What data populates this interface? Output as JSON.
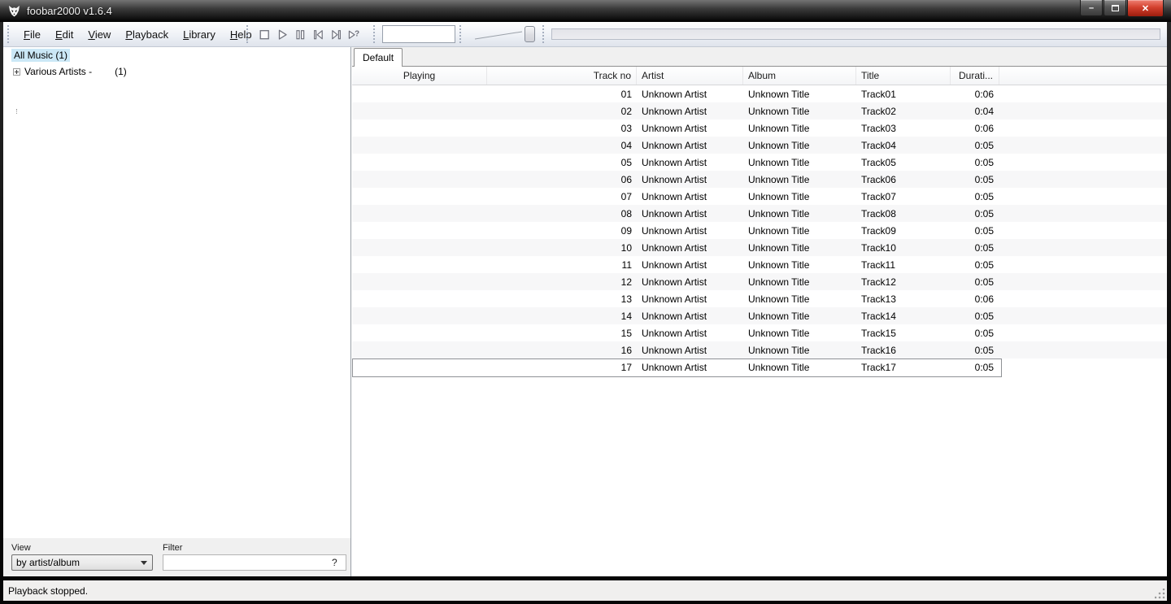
{
  "window": {
    "title": "foobar2000 v1.6.4",
    "controls": {
      "minimize": "–",
      "maximize": "",
      "close": "✕"
    }
  },
  "menu": {
    "items": [
      {
        "label": "File"
      },
      {
        "label": "Edit"
      },
      {
        "label": "View"
      },
      {
        "label": "Playback"
      },
      {
        "label": "Library"
      },
      {
        "label": "Help"
      }
    ]
  },
  "toolbar": {
    "transport_icons": [
      "stop-icon",
      "play-icon",
      "pause-icon",
      "previous-icon",
      "next-icon",
      "random-icon"
    ],
    "search_value": "",
    "volume_icon": "volume-slider",
    "seekbar_icon": "seekbar"
  },
  "library_panel": {
    "selected_node": "All Music (1)",
    "tree": [
      {
        "label": "Various Artists -",
        "count": "(1)"
      }
    ],
    "view_label": "View",
    "view_value": "by artist/album",
    "filter_label": "Filter",
    "filter_value": "",
    "filter_help": "?"
  },
  "playlist": {
    "tab_label": "Default",
    "columns": [
      {
        "key": "playing",
        "label": "Playing"
      },
      {
        "key": "track_no",
        "label": "Track no"
      },
      {
        "key": "artist",
        "label": "Artist"
      },
      {
        "key": "album",
        "label": "Album"
      },
      {
        "key": "title",
        "label": "Title"
      },
      {
        "key": "duration",
        "label": "Durati..."
      }
    ],
    "focused_row_index": 16,
    "rows": [
      {
        "playing": "",
        "track_no": "01",
        "artist": "Unknown Artist",
        "album": "Unknown Title",
        "title": "Track01",
        "duration": "0:06"
      },
      {
        "playing": "",
        "track_no": "02",
        "artist": "Unknown Artist",
        "album": "Unknown Title",
        "title": "Track02",
        "duration": "0:04"
      },
      {
        "playing": "",
        "track_no": "03",
        "artist": "Unknown Artist",
        "album": "Unknown Title",
        "title": "Track03",
        "duration": "0:06"
      },
      {
        "playing": "",
        "track_no": "04",
        "artist": "Unknown Artist",
        "album": "Unknown Title",
        "title": "Track04",
        "duration": "0:05"
      },
      {
        "playing": "",
        "track_no": "05",
        "artist": "Unknown Artist",
        "album": "Unknown Title",
        "title": "Track05",
        "duration": "0:05"
      },
      {
        "playing": "",
        "track_no": "06",
        "artist": "Unknown Artist",
        "album": "Unknown Title",
        "title": "Track06",
        "duration": "0:05"
      },
      {
        "playing": "",
        "track_no": "07",
        "artist": "Unknown Artist",
        "album": "Unknown Title",
        "title": "Track07",
        "duration": "0:05"
      },
      {
        "playing": "",
        "track_no": "08",
        "artist": "Unknown Artist",
        "album": "Unknown Title",
        "title": "Track08",
        "duration": "0:05"
      },
      {
        "playing": "",
        "track_no": "09",
        "artist": "Unknown Artist",
        "album": "Unknown Title",
        "title": "Track09",
        "duration": "0:05"
      },
      {
        "playing": "",
        "track_no": "10",
        "artist": "Unknown Artist",
        "album": "Unknown Title",
        "title": "Track10",
        "duration": "0:05"
      },
      {
        "playing": "",
        "track_no": "11",
        "artist": "Unknown Artist",
        "album": "Unknown Title",
        "title": "Track11",
        "duration": "0:05"
      },
      {
        "playing": "",
        "track_no": "12",
        "artist": "Unknown Artist",
        "album": "Unknown Title",
        "title": "Track12",
        "duration": "0:05"
      },
      {
        "playing": "",
        "track_no": "13",
        "artist": "Unknown Artist",
        "album": "Unknown Title",
        "title": "Track13",
        "duration": "0:06"
      },
      {
        "playing": "",
        "track_no": "14",
        "artist": "Unknown Artist",
        "album": "Unknown Title",
        "title": "Track14",
        "duration": "0:05"
      },
      {
        "playing": "",
        "track_no": "15",
        "artist": "Unknown Artist",
        "album": "Unknown Title",
        "title": "Track15",
        "duration": "0:05"
      },
      {
        "playing": "",
        "track_no": "16",
        "artist": "Unknown Artist",
        "album": "Unknown Title",
        "title": "Track16",
        "duration": "0:05"
      },
      {
        "playing": "",
        "track_no": "17",
        "artist": "Unknown Artist",
        "album": "Unknown Title",
        "title": "Track17",
        "duration": "0:05"
      }
    ]
  },
  "status_bar": {
    "text": "Playback stopped."
  }
}
